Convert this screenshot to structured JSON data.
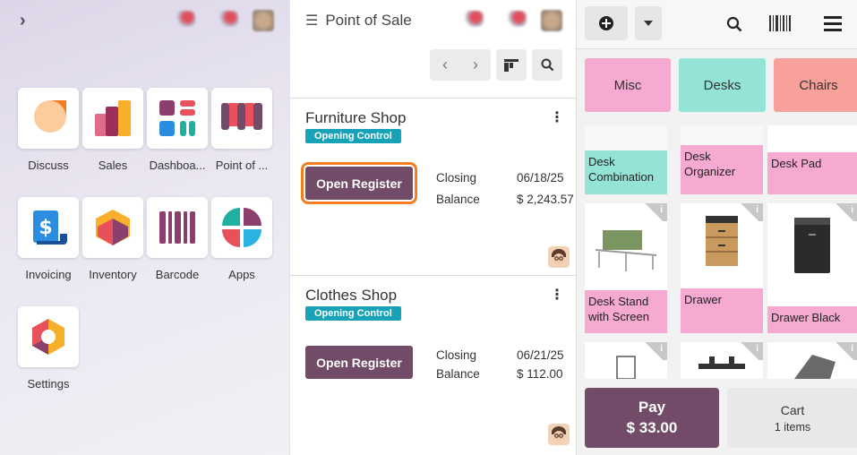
{
  "home": {
    "apps": [
      {
        "label": "Discuss",
        "icon": "discuss-icon"
      },
      {
        "label": "Sales",
        "icon": "sales-icon"
      },
      {
        "label": "Dashboa...",
        "icon": "dashboards-icon"
      },
      {
        "label": "Point of ...",
        "icon": "point-of-sale-icon"
      },
      {
        "label": "Invoicing",
        "icon": "invoicing-icon"
      },
      {
        "label": "Inventory",
        "icon": "inventory-icon"
      },
      {
        "label": "Barcode",
        "icon": "barcode-icon"
      },
      {
        "label": "Apps",
        "icon": "apps-icon"
      },
      {
        "label": "Settings",
        "icon": "settings-icon"
      }
    ]
  },
  "pos": {
    "title": "Point of Sale",
    "shops": [
      {
        "name": "Furniture Shop",
        "status": "Opening Control",
        "button": "Open Register",
        "closing_label": "Closing",
        "closing_value": "06/18/25",
        "balance_label": "Balance",
        "balance_value": "$ 2,243.57"
      },
      {
        "name": "Clothes Shop",
        "status": "Opening Control",
        "button": "Open Register",
        "closing_label": "Closing",
        "closing_value": "06/21/25",
        "balance_label": "Balance",
        "balance_value": "$ 112.00"
      }
    ]
  },
  "register": {
    "categories": [
      {
        "label": "Misc",
        "color": "#f6a9d1"
      },
      {
        "label": "Desks",
        "color": "#93e3d7"
      },
      {
        "label": "Chairs",
        "color": "#f8a09a"
      }
    ],
    "products": [
      {
        "name": "Desk Combination",
        "color": "#93e3d7"
      },
      {
        "name": "Desk Organizer",
        "color": "#f6a9d1"
      },
      {
        "name": "Desk Pad",
        "color": "#f6a9d1"
      },
      {
        "name": "Desk Stand with Screen",
        "color": "#f6a9d1"
      },
      {
        "name": "Drawer",
        "color": "#f6a9d1"
      },
      {
        "name": "Drawer Black",
        "color": "#f6a9d1"
      }
    ],
    "pay_label": "Pay",
    "pay_amount": "$ 33.00",
    "cart_label": "Cart",
    "cart_items": "1 items"
  },
  "colors": {
    "brand": "#714b67",
    "badge": "#17a2b8",
    "highlight": "#f57c1f"
  }
}
